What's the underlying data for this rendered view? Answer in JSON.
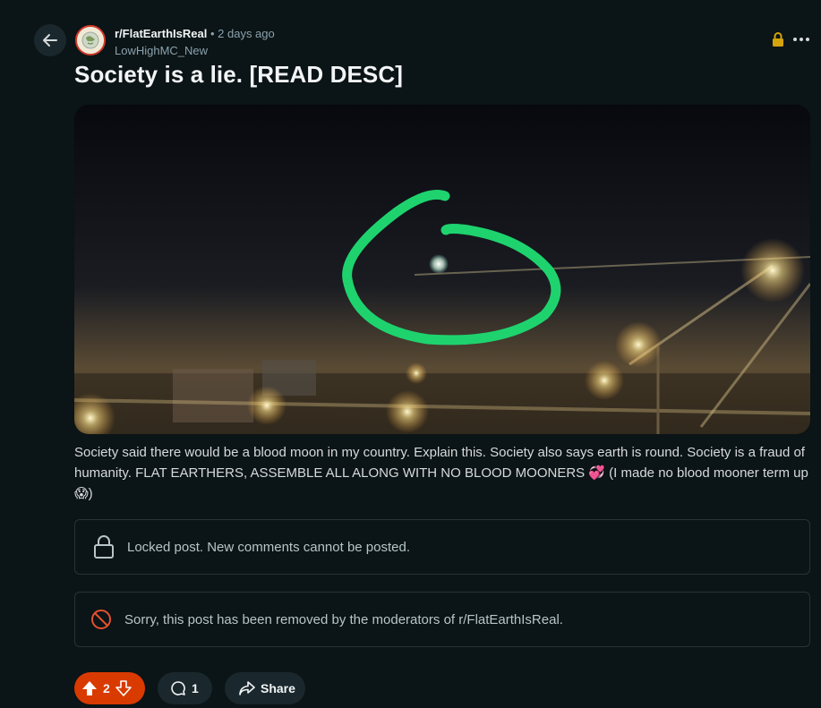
{
  "post": {
    "subreddit": "r/FlatEarthIsReal",
    "separator": "•",
    "time": "2 days ago",
    "author": "LowHighMC_New",
    "title": "Society is a lie. [READ DESC]",
    "body": "Society said there would be a blood moon in my country. Explain this. Society also says earth is round. Society is a fraud of humanity. FLAT EARTHERS, ASSEMBLE ALL ALONG WITH NO BLOOD MOONERS 💞 (I made no blood mooner term up 😱)"
  },
  "notices": {
    "locked": "Locked post. New comments cannot be posted.",
    "removed": "Sorry, this post has been removed by the moderators of r/FlatEarthIsReal."
  },
  "actions": {
    "vote_count": "2",
    "comment_count": "1",
    "share_label": "Share"
  },
  "icons": {
    "back": "arrow-left-icon",
    "locked_badge": "lock-icon",
    "more": "ellipsis-icon",
    "locked_notice": "padlock-icon",
    "removed": "ban-icon",
    "upvote": "upvote-icon",
    "downvote": "downvote-icon",
    "comment": "comment-icon",
    "share": "share-icon"
  },
  "colors": {
    "background": "#0b1416",
    "upvoted": "#d93a00",
    "lock_badge": "#d4a20b",
    "removed_icon": "#e4502e",
    "annotation_circle": "#1ed36e"
  }
}
